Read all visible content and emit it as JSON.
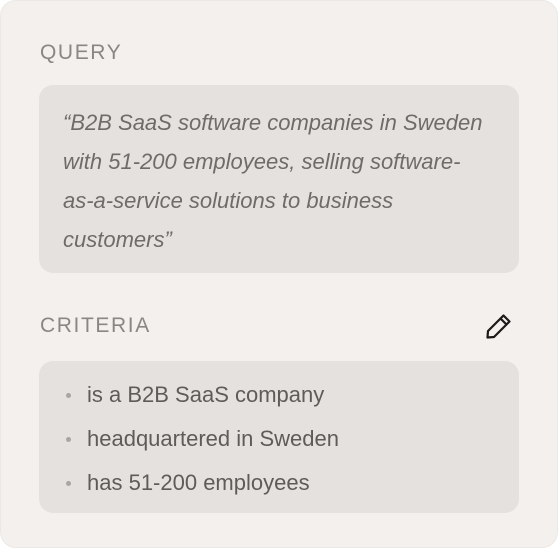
{
  "query": {
    "label": "QUERY",
    "text": "“B2B SaaS software companies in Sweden with 51-200 employees, selling software-as-a-service solutions to business customers”"
  },
  "criteria": {
    "label": "CRITERIA",
    "edit_icon": "pencil-icon",
    "items": [
      {
        "label": "is a B2B SaaS company"
      },
      {
        "label": "headquartered in Sweden"
      },
      {
        "label": "has 51-200 employees"
      }
    ]
  },
  "colors": {
    "panel_background": "#f3f0ee",
    "box_background": "#e5e1de",
    "label_text": "#8a8684",
    "body_text": "#5f5b58"
  }
}
